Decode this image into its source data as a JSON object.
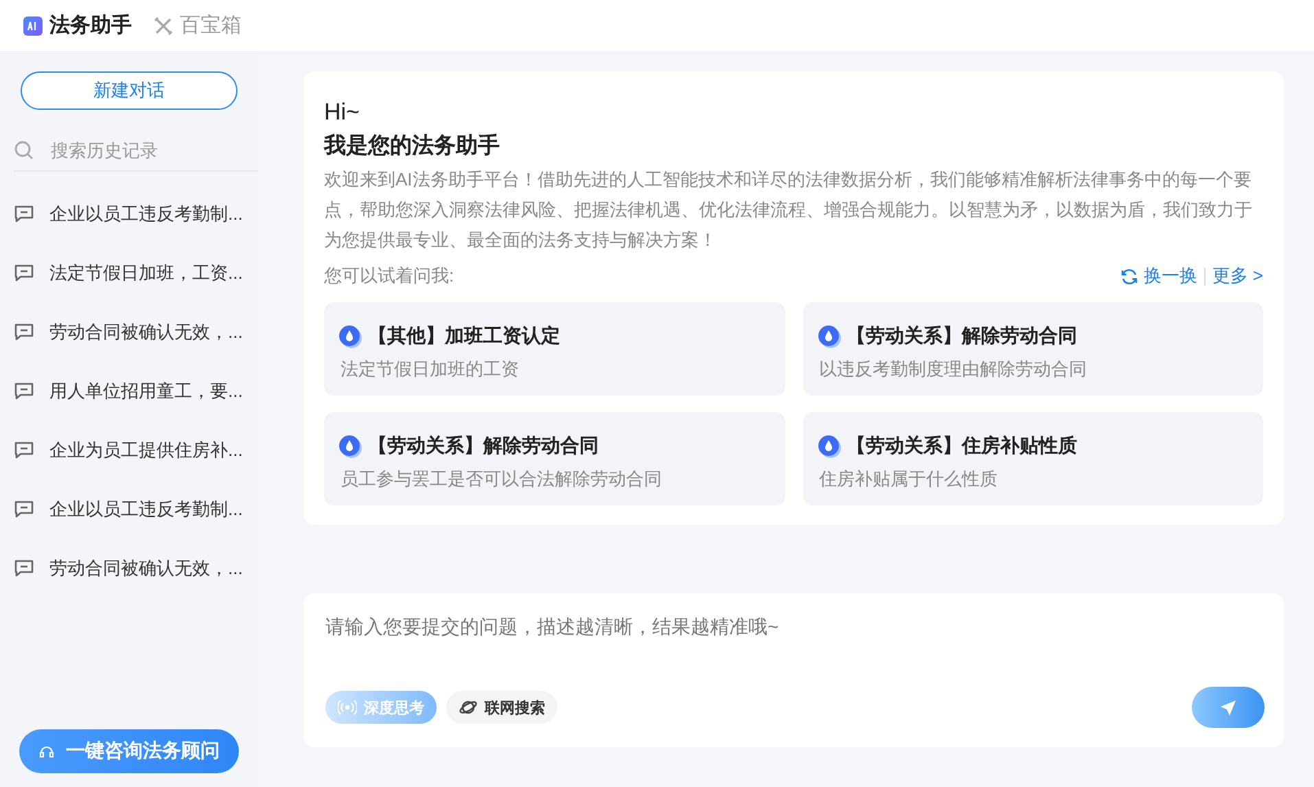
{
  "tabs": [
    {
      "label": "法务助手",
      "selected": true,
      "kind": "ai"
    },
    {
      "label": "百宝箱",
      "selected": false,
      "kind": "tools"
    }
  ],
  "sidebar": {
    "new_chat": "新建对话",
    "search": {
      "placeholder": "搜索历史记录"
    },
    "history": [
      "企业以员工违反考勤制...",
      "法定节假日加班，工资...",
      "劳动合同被确认无效，...",
      "用人单位招用童工，要...",
      "企业为员工提供住房补...",
      "企业以员工违反考勤制...",
      "劳动合同被确认无效，..."
    ],
    "consult_button": "一键咨询法务顾问"
  },
  "welcome": {
    "greeting": "Hi~",
    "title": "我是您的法务助手",
    "intro": "欢迎来到AI法务助手平台！借助先进的人工智能技术和详尽的法律数据分析，我们能够精准解析法律事务中的每一个要点，帮助您深入洞察法律风险、把握法律机遇、优化法律流程、增强合规能力。以智慧为矛，以数据为盾，我们致力于为您提供最专业、最全面的法务支持与解决方案！",
    "prompt_label": "您可以试着问我:",
    "refresh": "换一换",
    "more": "更多 >",
    "suggestions": [
      {
        "title": "【其他】加班工资认定",
        "subtitle": "法定节假日加班的工资"
      },
      {
        "title": "【劳动关系】解除劳动合同",
        "subtitle": "以违反考勤制度理由解除劳动合同"
      },
      {
        "title": "【劳动关系】解除劳动合同",
        "subtitle": "员工参与罢工是否可以合法解除劳动合同"
      },
      {
        "title": "【劳动关系】住房补贴性质",
        "subtitle": "住房补贴属于什么性质"
      }
    ]
  },
  "composer": {
    "placeholder": "请输入您要提交的问题，描述越清晰，结果越精准哦~",
    "toggles": [
      {
        "label": "深度思考",
        "on": true,
        "kind": "think"
      },
      {
        "label": "联网搜索",
        "on": false,
        "kind": "web"
      }
    ]
  }
}
